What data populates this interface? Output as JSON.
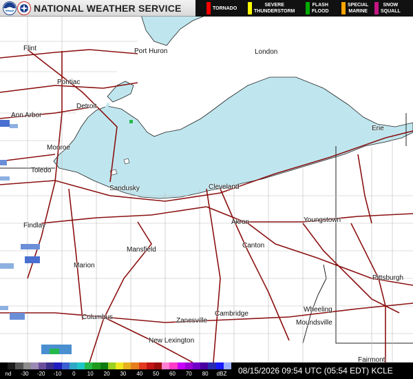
{
  "header": {
    "agency": "NATIONAL WEATHER SERVICE",
    "logos": [
      "noaa-logo",
      "nws-logo"
    ]
  },
  "legend": [
    {
      "label": "TORNADO",
      "color": "#ff0000"
    },
    {
      "label": "SEVERE\nTHUNDERSTORM",
      "color": "#ffff00"
    },
    {
      "label": "FLASH\nFLOOD",
      "color": "#00aa00"
    },
    {
      "label": "SPECIAL\nMARINE",
      "color": "#ffa500"
    },
    {
      "label": "SNOW\nSQUALL",
      "color": "#c71585"
    }
  ],
  "map": {
    "water_color": "#bfe6ee",
    "land_color": "#ffffff",
    "road_color": "#8b1010",
    "cities": [
      {
        "id": "flint",
        "name": "Flint"
      },
      {
        "id": "port-huron",
        "name": "Port Huron"
      },
      {
        "id": "london",
        "name": "London"
      },
      {
        "id": "pontiac",
        "name": "Pontiac"
      },
      {
        "id": "detroit",
        "name": "Detroit"
      },
      {
        "id": "ann-arbor",
        "name": "Ann Arbor"
      },
      {
        "id": "monroe",
        "name": "Monroe"
      },
      {
        "id": "toledo",
        "name": "Toledo"
      },
      {
        "id": "sandusky",
        "name": "Sandusky"
      },
      {
        "id": "erie",
        "name": "Erie"
      },
      {
        "id": "cleveland",
        "name": "Cleveland"
      },
      {
        "id": "findlay",
        "name": "Findlay"
      },
      {
        "id": "akron",
        "name": "Akron"
      },
      {
        "id": "youngstown",
        "name": "Youngstown"
      },
      {
        "id": "mansfield",
        "name": "Mansfield"
      },
      {
        "id": "canton",
        "name": "Canton"
      },
      {
        "id": "marion",
        "name": "Marion"
      },
      {
        "id": "pittsburgh",
        "name": "Pittsburgh"
      },
      {
        "id": "wheeling",
        "name": "Wheeling"
      },
      {
        "id": "columbus",
        "name": "Columbus"
      },
      {
        "id": "cambridge",
        "name": "Cambridge"
      },
      {
        "id": "moundsville",
        "name": "Moundsville"
      },
      {
        "id": "zanesville",
        "name": "Zanesville"
      },
      {
        "id": "new-lexington",
        "name": "New Lexington"
      },
      {
        "id": "fairmont",
        "name": "Fairmont"
      }
    ]
  },
  "footer": {
    "scale_labels": [
      "nd",
      "-30",
      "-20",
      "-10",
      "0",
      "10",
      "20",
      "30",
      "40",
      "50",
      "60",
      "70",
      "80",
      "dBZ"
    ],
    "scale_colors": [
      "#000000",
      "#1c1c1c",
      "#555555",
      "#8c8c8c",
      "#9b89b6",
      "#6c4f9c",
      "#3a2f8c",
      "#1f1fbf",
      "#3a5fd0",
      "#2fa7c6",
      "#1ec8c8",
      "#25b84a",
      "#1e9b1e",
      "#0d7a0d",
      "#9bd01e",
      "#f0e81e",
      "#e6b01e",
      "#e67e1e",
      "#e23a1e",
      "#c21414",
      "#9b0d0d",
      "#ff7fd2",
      "#ff3cc8",
      "#c800ff",
      "#9b00d6",
      "#6f00c8",
      "#4a00a0",
      "#2a2ab0",
      "#1a1aff",
      "#9bb0ff"
    ],
    "timestamp": "08/15/2026 09:54 UTC (05:54 EDT)  KCLE"
  }
}
